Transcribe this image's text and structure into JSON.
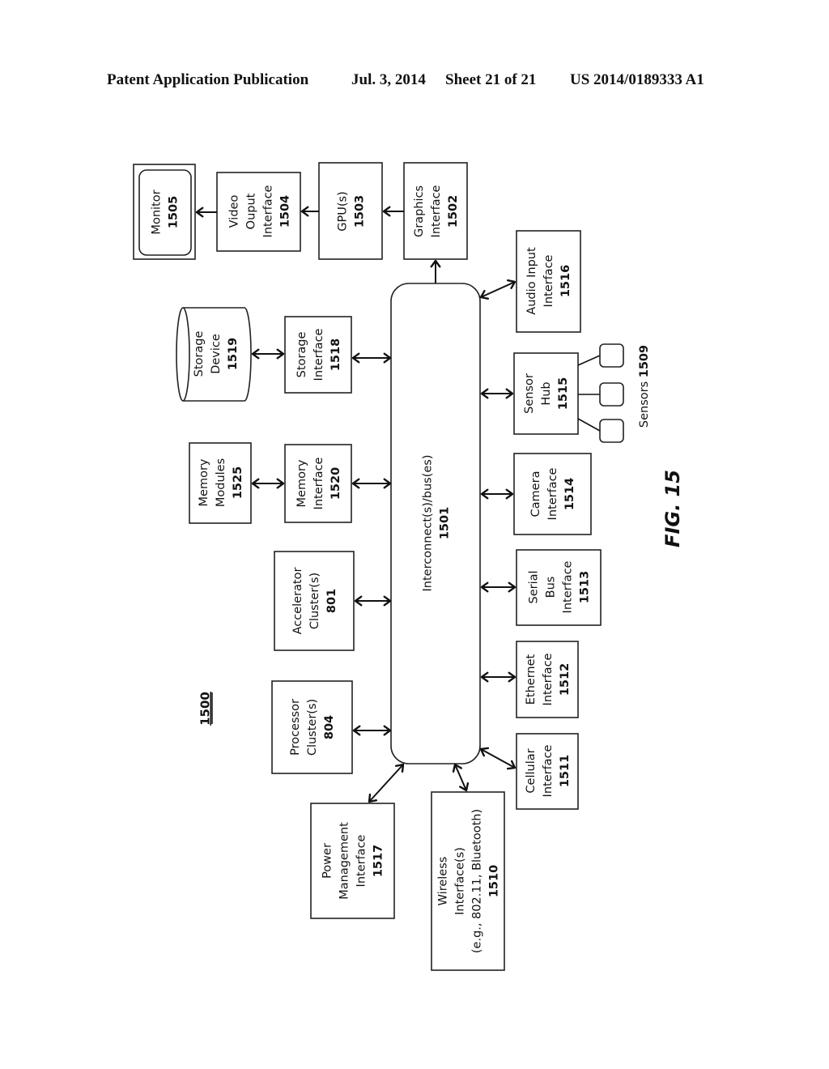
{
  "header": {
    "publication": "Patent Application Publication",
    "date": "Jul. 3, 2014",
    "sheet": "Sheet 21 of 21",
    "number": "US 2014/0189333 A1"
  },
  "figure": {
    "label": "FIG. 15",
    "ref": "1500"
  },
  "blocks": {
    "monitor": {
      "lines": [
        "Monitor"
      ],
      "num": "1505"
    },
    "video_output": {
      "lines": [
        "Video",
        "Ouput",
        "Interface"
      ],
      "num": "1504"
    },
    "gpu": {
      "lines": [
        "GPU(s)"
      ],
      "num": "1503"
    },
    "graphics": {
      "lines": [
        "Graphics",
        "Interface"
      ],
      "num": "1502"
    },
    "storage_device": {
      "lines": [
        "Storage",
        "Device"
      ],
      "num": "1519"
    },
    "storage_interface": {
      "lines": [
        "Storage",
        "Interface"
      ],
      "num": "1518"
    },
    "memory_modules": {
      "lines": [
        "Memory",
        "Modules"
      ],
      "num": "1525"
    },
    "memory_interface": {
      "lines": [
        "Memory",
        "Interface"
      ],
      "num": "1520"
    },
    "accelerator": {
      "lines": [
        "Accelerator",
        "Cluster(s)"
      ],
      "num": "801"
    },
    "processor": {
      "lines": [
        "Processor",
        "Cluster(s)"
      ],
      "num": "804"
    },
    "interconnect": {
      "lines": [
        "Interconnect(s)/bus(es)"
      ],
      "num": "1501"
    },
    "audio": {
      "lines": [
        "Audio Input",
        "Interface"
      ],
      "num": "1516"
    },
    "sensor_hub": {
      "lines": [
        "Sensor",
        "Hub"
      ],
      "num": "1515"
    },
    "sensors": {
      "label": "Sensors",
      "num": "1509"
    },
    "camera": {
      "lines": [
        "Camera",
        "Interface"
      ],
      "num": "1514"
    },
    "serial": {
      "lines": [
        "Serial",
        "Bus",
        "Interface"
      ],
      "num": "1513"
    },
    "ethernet": {
      "lines": [
        "Ethernet",
        "Interface"
      ],
      "num": "1512"
    },
    "cellular": {
      "lines": [
        "Cellular",
        "Interface"
      ],
      "num": "1511"
    },
    "power": {
      "lines": [
        "Power",
        "Management",
        "Interface"
      ],
      "num": "1517"
    },
    "wireless": {
      "lines": [
        "Wireless",
        "Interface(s)",
        "(e.g., 802.11, Bluetooth)"
      ],
      "num": "1510"
    }
  }
}
